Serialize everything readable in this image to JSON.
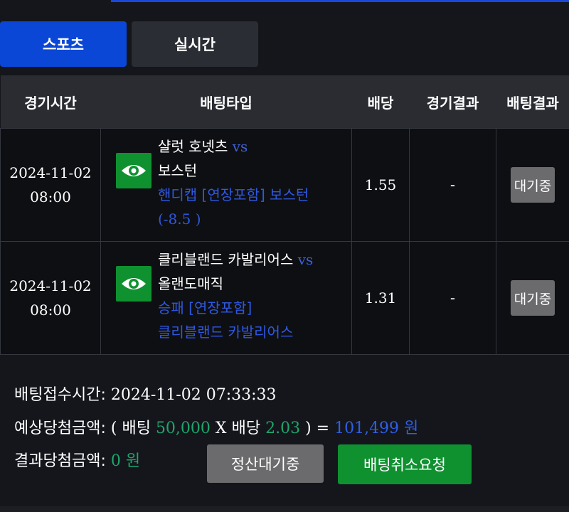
{
  "tabs": [
    {
      "label": "스포츠",
      "active": true
    },
    {
      "label": "실시간",
      "active": false
    }
  ],
  "table": {
    "headers": [
      "경기시간",
      "배팅타입",
      "배당",
      "경기결과",
      "배팅결과"
    ],
    "rows": [
      {
        "date": "2024-11-02",
        "time": "08:00",
        "home": "샬럿 호넷츠",
        "vs": "vs",
        "away": "보스턴",
        "pick_line1": "핸디캡 [연장포함] 보스턴",
        "pick_line2": "(-8.5 )",
        "odds": "1.55",
        "result": "-",
        "status": "대기중"
      },
      {
        "date": "2024-11-02",
        "time": "08:00",
        "home": "클리블랜드 카발리어스",
        "vs": "vs",
        "away": "올랜도매직",
        "pick_line1": "승패 [연장포함]",
        "pick_line2": "클리블랜드 카발리어스",
        "odds": "1.31",
        "result": "-",
        "status": "대기중"
      }
    ]
  },
  "summary": {
    "bet_time_label": "배팅접수시간:",
    "bet_time_value": "2024-11-02 07:33:33",
    "expected_label": "예상당첨금액:",
    "open_paren": "(",
    "bet_word": "배팅",
    "bet_amount": "50,000",
    "times": "X",
    "odds_word": "배당",
    "total_odds": "2.03",
    "close_eq": ") =",
    "expected_amount": "101,499 원",
    "result_label": "결과당첨금액:",
    "result_amount": "0 원"
  },
  "buttons": {
    "settle": "정산대기중",
    "cancel": "배팅취소요청"
  },
  "icons": {
    "row_action": "eye-icon"
  },
  "colors": {
    "accent": "#0b47d6",
    "green": "#0f9130",
    "value_green": "#1fa66a",
    "link_blue": "#2f58e0"
  }
}
